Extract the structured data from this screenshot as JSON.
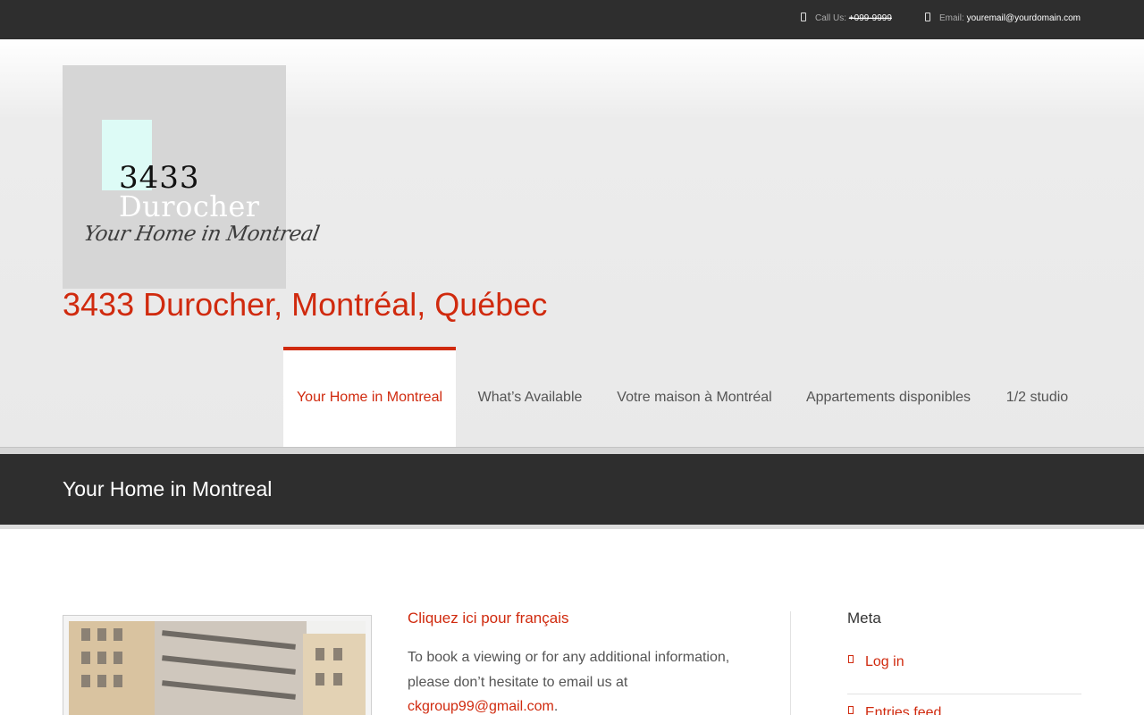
{
  "topbar": {
    "phone_label": "Call Us:",
    "phone_value": "+099-9999",
    "email_label": "Email:",
    "email_value": "youremail@yourdomain.com"
  },
  "header": {
    "logo": {
      "number": "3433",
      "name": "Durocher",
      "tagline": "Your Home in Montreal"
    },
    "site_title": "3433 Durocher, Montréal, Québec"
  },
  "nav": {
    "items": [
      {
        "label": "Your Home in Montreal",
        "active": true
      },
      {
        "label": "What’s Available",
        "active": false
      },
      {
        "label": "Votre maison à Montréal",
        "active": false
      },
      {
        "label": "Appartements disponibles",
        "active": false
      },
      {
        "label": "1/2 studio",
        "active": false
      }
    ]
  },
  "page": {
    "title": "Your Home in Montreal"
  },
  "content": {
    "french_link": "Cliquez ici pour français",
    "intro_text": "To book a viewing or for any additional information, please don’t hesitate to email us at",
    "contact_email": "ckgroup99@gmail.com",
    "trailing_period": "."
  },
  "sidebar": {
    "heading": "Meta",
    "links": [
      "Log in",
      "Entries feed"
    ]
  },
  "colors": {
    "accent": "#d02a0e",
    "dark_bar": "#2e2e2e"
  }
}
